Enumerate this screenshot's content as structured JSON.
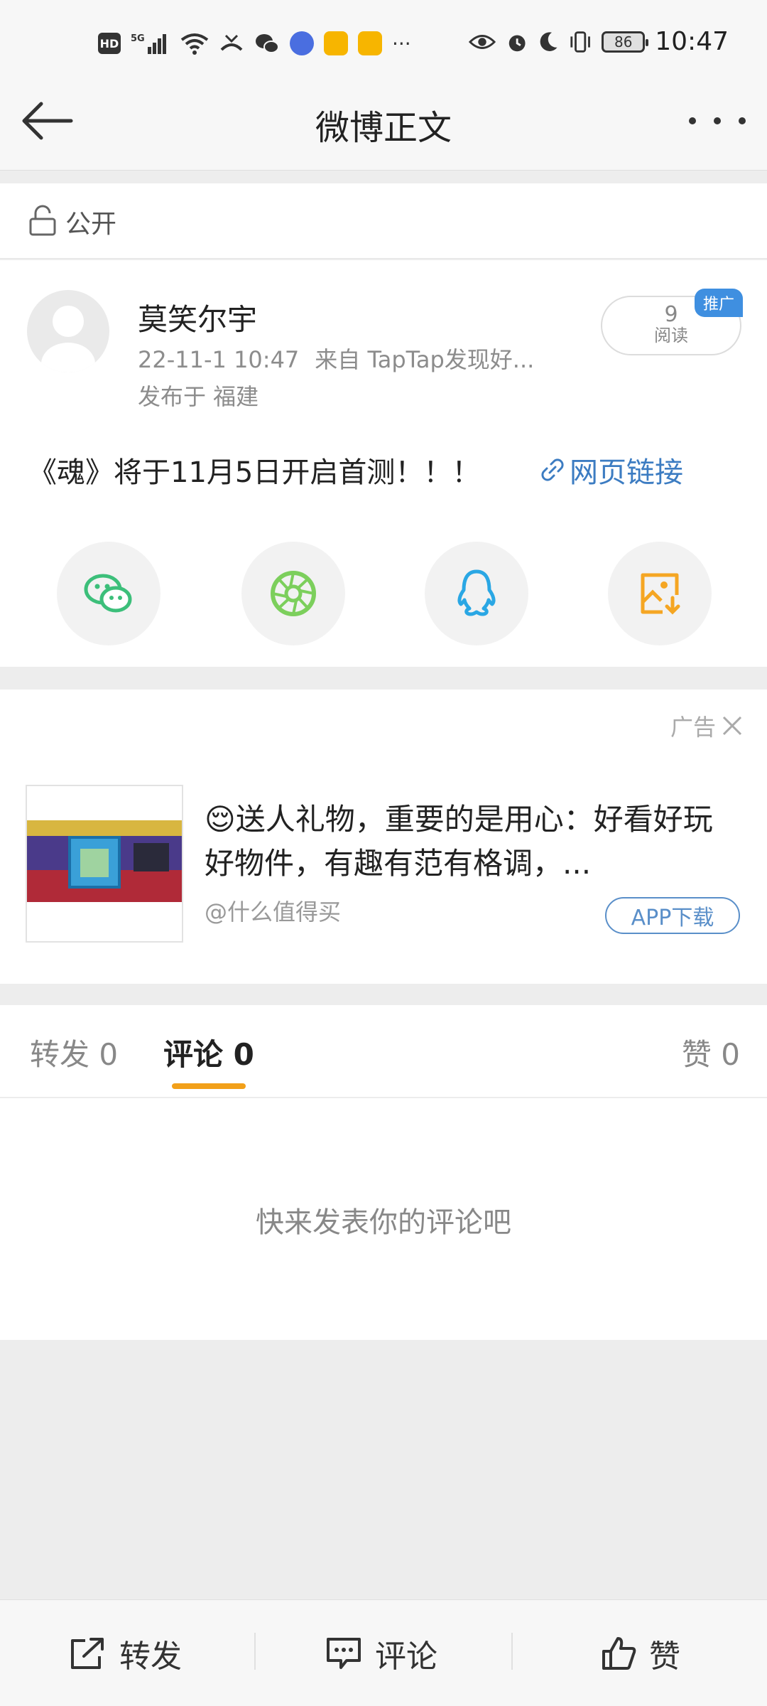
{
  "status_bar": {
    "time": "10:47",
    "battery": "86",
    "hd_label": "HD",
    "more_indicator": "···",
    "left_icons": [
      "hd-icon",
      "5g-signal-icon",
      "wifi-icon",
      "missed-call-icon",
      "wechat-icon",
      "music-icon",
      "weibo-icon",
      "weibo-icon"
    ],
    "right_icons": [
      "eye-icon",
      "alarm-icon",
      "moon-icon",
      "vibrate-icon",
      "battery-icon"
    ]
  },
  "nav": {
    "title": "微博正文",
    "back_icon": "back-arrow-icon",
    "more_icon": "more-dots-icon"
  },
  "visibility": {
    "label": "公开",
    "icon": "unlock-icon"
  },
  "post": {
    "username": "莫笑尔宇",
    "timestamp": "22-11-1 10:47",
    "source": "来自 TapTap发现好...",
    "location": "发布于 福建",
    "read_count": "9",
    "read_label": "阅读",
    "promo_badge": "推广",
    "text": "《魂》将于11月5日开启首测！！！",
    "link_text": "网页链接",
    "share_icons": [
      "wechat-icon",
      "moments-icon",
      "qq-icon",
      "save-image-icon"
    ],
    "colors": {
      "wechat": "#3cbf7a",
      "moments": "#7ccf5c",
      "qq": "#2aa7e4",
      "save": "#f5a623",
      "link": "#3c7cc2"
    }
  },
  "ad": {
    "label": "广告",
    "title": "送人礼物，重要的是用心：好看好玩好物件，有趣有范有格调，...",
    "emoji": "😌",
    "source": "@什么值得买",
    "button": "APP下载"
  },
  "tabs": {
    "repost": "转发 0",
    "comment": "评论 0",
    "like": "赞 0",
    "active_color": "#f2a019"
  },
  "comments": {
    "empty_text": "快来发表你的评论吧"
  },
  "bottom_bar": {
    "repost": "转发",
    "comment": "评论",
    "like": "赞"
  }
}
